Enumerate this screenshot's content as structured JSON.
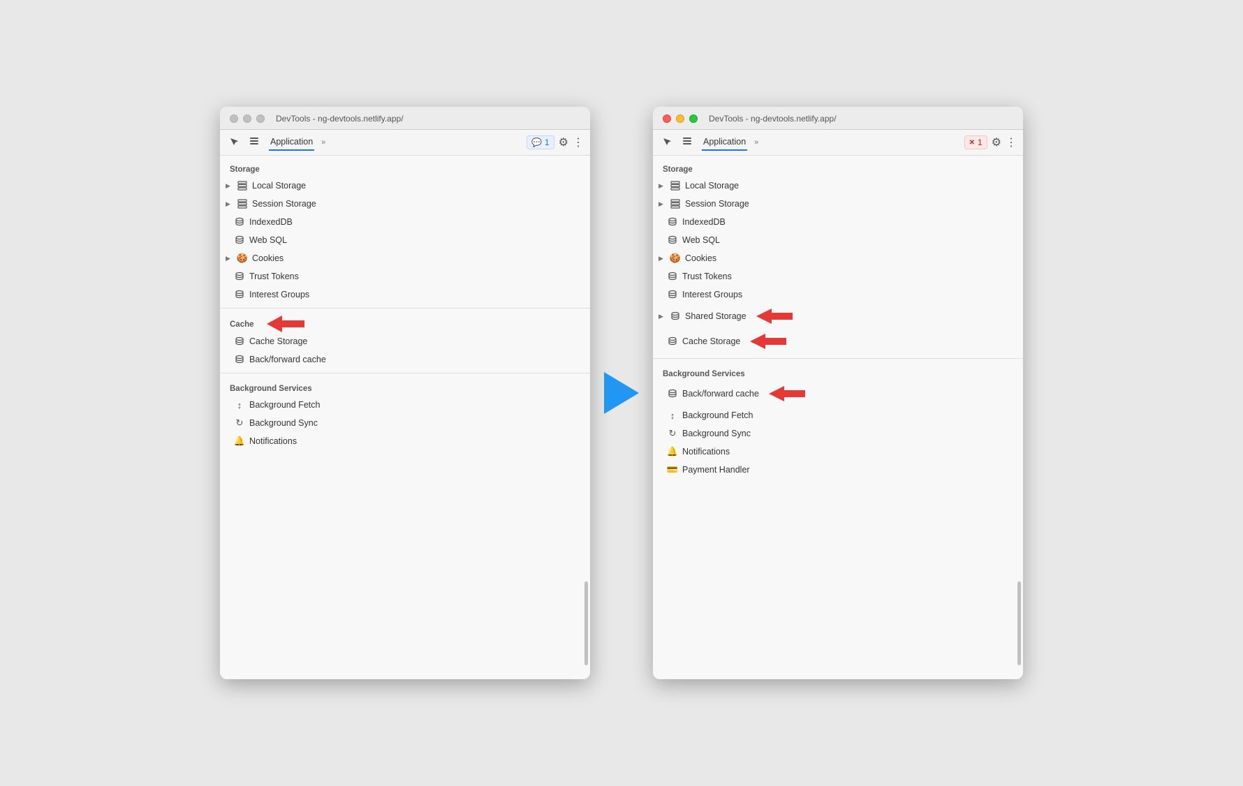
{
  "window_left": {
    "title": "DevTools - ng-devtools.netlify.app/",
    "active": false,
    "toolbar": {
      "tab": "Application",
      "badge_label": "1",
      "badge_icon": "💬"
    },
    "storage_section": "Storage",
    "items_storage": [
      {
        "label": "Local Storage",
        "expandable": true,
        "icon": "grid"
      },
      {
        "label": "Session Storage",
        "expandable": true,
        "icon": "grid"
      },
      {
        "label": "IndexedDB",
        "expandable": false,
        "icon": "db"
      },
      {
        "label": "Web SQL",
        "expandable": false,
        "icon": "db"
      },
      {
        "label": "Cookies",
        "expandable": true,
        "icon": "cookie"
      },
      {
        "label": "Trust Tokens",
        "expandable": false,
        "icon": "db"
      },
      {
        "label": "Interest Groups",
        "expandable": false,
        "icon": "db"
      }
    ],
    "cache_section": "Cache",
    "items_cache": [
      {
        "label": "Cache Storage",
        "expandable": false,
        "icon": "db"
      },
      {
        "label": "Back/forward cache",
        "expandable": false,
        "icon": "db"
      }
    ],
    "bg_section": "Background Services",
    "items_bg": [
      {
        "label": "Background Fetch",
        "expandable": false,
        "icon": "arrows"
      },
      {
        "label": "Background Sync",
        "expandable": false,
        "icon": "sync"
      },
      {
        "label": "Notifications",
        "expandable": false,
        "icon": "bell"
      }
    ],
    "annotations": {
      "cache_header_arrow": true
    }
  },
  "window_right": {
    "title": "DevTools - ng-devtools.netlify.app/",
    "active": true,
    "toolbar": {
      "tab": "Application",
      "badge_label": "1",
      "badge_icon": "✕"
    },
    "storage_section": "Storage",
    "items_storage": [
      {
        "label": "Local Storage",
        "expandable": true,
        "icon": "grid"
      },
      {
        "label": "Session Storage",
        "expandable": true,
        "icon": "grid"
      },
      {
        "label": "IndexedDB",
        "expandable": false,
        "icon": "db"
      },
      {
        "label": "Web SQL",
        "expandable": false,
        "icon": "db"
      },
      {
        "label": "Cookies",
        "expandable": true,
        "icon": "cookie"
      },
      {
        "label": "Trust Tokens",
        "expandable": false,
        "icon": "db"
      },
      {
        "label": "Interest Groups",
        "expandable": false,
        "icon": "db"
      },
      {
        "label": "Shared Storage",
        "expandable": true,
        "icon": "db",
        "arrow": true
      },
      {
        "label": "Cache Storage",
        "expandable": false,
        "icon": "db",
        "arrow": true
      }
    ],
    "bg_section": "Background Services",
    "items_bg": [
      {
        "label": "Back/forward cache",
        "expandable": false,
        "icon": "db",
        "arrow": true
      },
      {
        "label": "Background Fetch",
        "expandable": false,
        "icon": "arrows"
      },
      {
        "label": "Background Sync",
        "expandable": false,
        "icon": "sync"
      },
      {
        "label": "Notifications",
        "expandable": false,
        "icon": "bell"
      },
      {
        "label": "Payment Handler",
        "expandable": false,
        "icon": "card"
      }
    ]
  },
  "arrow": {
    "color": "#2196f3"
  }
}
